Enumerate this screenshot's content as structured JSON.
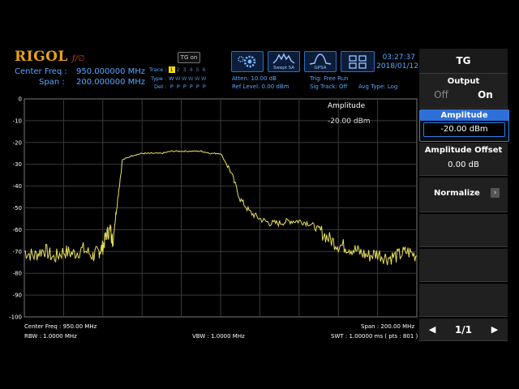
{
  "header": {
    "logo": "RIGOL",
    "logo_sub": "ƒ/∅",
    "tg_badge": "TG on",
    "center_freq_label": "Center Freq :",
    "center_freq_value": "950.000000 MHz",
    "span_label": "Span :",
    "span_value": "200.000000 MHz",
    "trace_label": "Trace :",
    "type_label": "Type :",
    "det_label": "Det :",
    "trace_numbers": [
      "1",
      "2",
      "3",
      "4",
      "5",
      "6"
    ],
    "trace_types": [
      "W",
      "W",
      "W",
      "W",
      "W",
      "W"
    ],
    "trace_dets": [
      "P",
      "P",
      "P",
      "P",
      "P",
      "P"
    ],
    "atten": "Atten: 10.00 dB",
    "ref_level": "Ref Level: 0.00 dBm",
    "trig": "Trig: Free Run",
    "sig_track": "Sig Track: Off",
    "avg_type": "Avg Type: Log",
    "icons": [
      {
        "name": "settings-gear-icon",
        "label": ""
      },
      {
        "name": "swept-sa-icon",
        "label": "Swept SA"
      },
      {
        "name": "gpsa-icon",
        "label": "GPSA"
      },
      {
        "name": "window-layout-icon",
        "label": ""
      }
    ],
    "time": "03:27:37",
    "date": "2018/01/12"
  },
  "plot": {
    "amplitude_label": "Amplitude",
    "amplitude_value": "-20.00 dBm",
    "foot_center": "Center Freq : 950.00 MHz",
    "foot_span": "Span : 200.00 MHz",
    "foot_rbw": "RBW : 1.0000 MHz",
    "foot_vbw": "VBW : 1.0000 MHz",
    "foot_swt": "SWT : 1.00000 ms ( pts : 801 )"
  },
  "chart_data": {
    "type": "line",
    "y_ticks": [
      "0",
      "-10",
      "-20",
      "-30",
      "-40",
      "-50",
      "-60",
      "-70",
      "-80",
      "-90",
      "-100"
    ],
    "ylim": [
      -100,
      0
    ],
    "xlim": [
      850,
      1050
    ],
    "grid": true,
    "series": [
      {
        "color": "#e8e060",
        "x": [
          850,
          855,
          860,
          865,
          870,
          875,
          880,
          885,
          888,
          890,
          892,
          894,
          895,
          897,
          900,
          905,
          910,
          915,
          920,
          925,
          930,
          935,
          940,
          945,
          950,
          955,
          960,
          965,
          970,
          975,
          980,
          985,
          990,
          995,
          1000,
          1005,
          1010,
          1015,
          1020,
          1025,
          1030,
          1035,
          1040,
          1045,
          1050
        ],
        "y": [
          -70,
          -72,
          -69,
          -73,
          -70,
          -71,
          -69,
          -72,
          -70,
          -68,
          -62,
          -60,
          -66,
          -50,
          -28,
          -26,
          -25,
          -25,
          -25,
          -24,
          -24,
          -24,
          -24,
          -25,
          -25,
          -33,
          -46,
          -52,
          -55,
          -57,
          -57,
          -56,
          -56,
          -57,
          -60,
          -64,
          -67,
          -68,
          -70,
          -72,
          -71,
          -73,
          -72,
          -70,
          -72
        ]
      }
    ]
  },
  "panel": {
    "title": "TG",
    "output_label": "Output",
    "output_off": "Off",
    "output_on": "On",
    "amplitude_label": "Amplitude",
    "amplitude_value": "-20.00 dBm",
    "offset_label": "Amplitude Offset",
    "offset_value": "0.00 dB",
    "normalize_label": "Normalize",
    "page": "1/1"
  },
  "colors": {
    "accent_blue": "#2f7ee8",
    "trace_yellow": "#e8e060",
    "logo_orange": "#e8a31a"
  }
}
